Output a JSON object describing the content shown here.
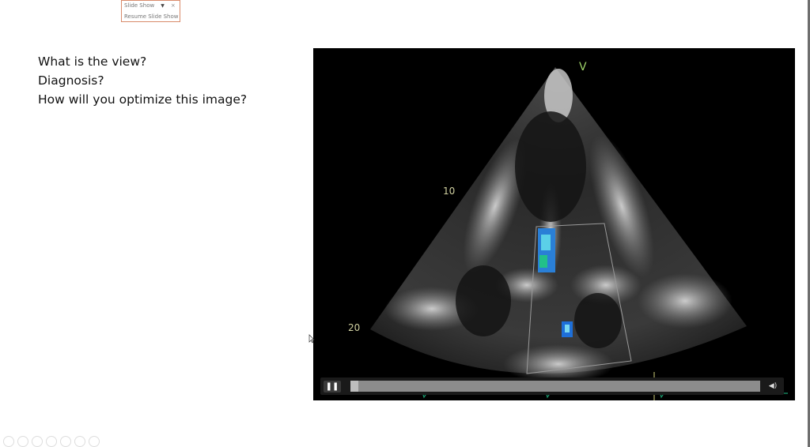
{
  "slideshow_widget": {
    "label": "Slide Show",
    "dropdown_icon": "chevron-down-icon",
    "close_icon": "close-icon",
    "resume_label": "Resume Slide Show"
  },
  "slide": {
    "questions": [
      "What is the view?",
      "Diagnosis?",
      "How will you optimize this image?"
    ]
  },
  "video": {
    "orientation_marker": "V",
    "depth_labels": [
      "10",
      "20"
    ],
    "progress_percent": 2,
    "pause_icon": "pause-icon",
    "volume_icon": "volume-icon"
  },
  "colors": {
    "ecg_trace": "#1a9a6e",
    "marker": "#9fd36a",
    "widget_border": "#d98b6b"
  }
}
